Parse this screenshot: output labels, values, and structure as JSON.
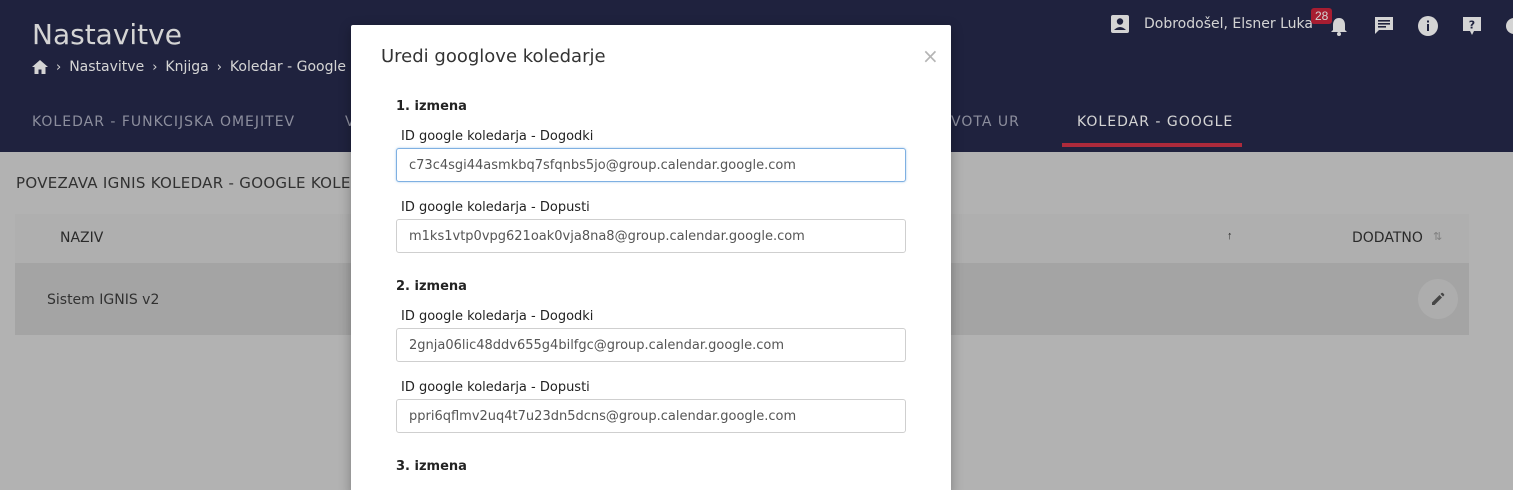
{
  "header": {
    "title": "Nastavitve",
    "breadcrumb": [
      "Nastavitve",
      "Knjiga",
      "Koledar - Google"
    ],
    "user_greeting": "Dobrodošel, Elsner Luka",
    "notification_count": "28"
  },
  "tabs": [
    {
      "label": "KOLEDAR - FUNKCIJSKA OMEJITEV"
    },
    {
      "label": "V"
    },
    {
      "label": "VOTA UR"
    },
    {
      "label": "KOLEDAR - GOOGLE"
    }
  ],
  "main": {
    "section_title": "POVEZAVA IGNIS KOLEDAR - GOOGLE KOLED",
    "columns": [
      "NAZIV",
      "DODATNO"
    ],
    "rows": [
      {
        "naziv": "Sistem IGNIS v2"
      }
    ]
  },
  "modal": {
    "title": "Uredi googlove koledarje",
    "close": "×",
    "groups": [
      {
        "title": "1. izmena",
        "events_label": "ID google koledarja - Dogodki",
        "events_value": "c73c4sgi44asmkbq7sfqnbs5jo@group.calendar.google.com",
        "leave_label": "ID google koledarja - Dopusti",
        "leave_value": "m1ks1vtp0vpg621oak0vja8na8@group.calendar.google.com"
      },
      {
        "title": "2. izmena",
        "events_label": "ID google koledarja - Dogodki",
        "events_value": "2gnja06lic48ddv655g4bilfgc@group.calendar.google.com",
        "leave_label": "ID google koledarja - Dopusti",
        "leave_value": "ppri6qflmv2uq4t7u23dn5dcns@group.calendar.google.com"
      },
      {
        "title": "3. izmena"
      }
    ]
  },
  "colors": {
    "header_bg": "#262a4b",
    "accent": "#d03348",
    "badge": "#c9233b"
  },
  "icons": [
    "home-icon",
    "user-icon",
    "bell-icon",
    "chat-icon",
    "info-icon",
    "help-icon",
    "pencil-icon",
    "sort-icon"
  ]
}
